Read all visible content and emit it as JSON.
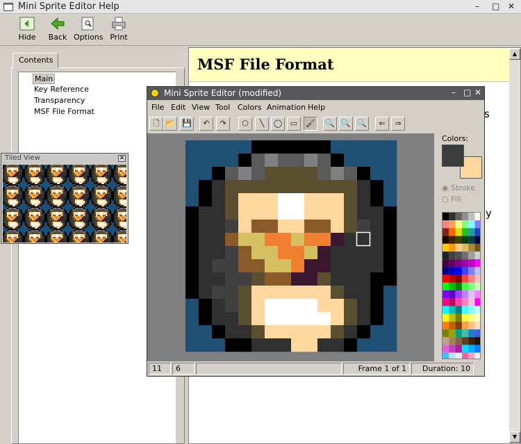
{
  "help_window": {
    "title": "Mini Sprite Editor Help",
    "controls": {
      "minimize": "–",
      "maximize": "□",
      "close": "✕"
    },
    "toolbar": [
      {
        "label": "Hide",
        "icon": "hide-icon"
      },
      {
        "label": "Back",
        "icon": "back-arrow-icon"
      },
      {
        "label": "Options",
        "icon": "options-icon"
      },
      {
        "label": "Print",
        "icon": "printer-icon"
      }
    ],
    "tab_label": "Contents",
    "tree_items": [
      "Main",
      "Key Reference",
      "Transparency",
      "MSF File Format"
    ],
    "selected_item": "Main",
    "doc_title": "MSF File Format",
    "doc_fragments": [
      "s",
      "y"
    ]
  },
  "tiled_view": {
    "title": "Tiled View",
    "close": "✕"
  },
  "editor": {
    "title": "Mini Sprite Editor (modified)",
    "controls": {
      "minimize": "–",
      "maximize": "□",
      "close": "✕"
    },
    "menu": [
      "File",
      "Edit",
      "View",
      "Tool",
      "Colors",
      "Animation",
      "Help"
    ],
    "tools": [
      {
        "name": "new-icon",
        "glyph": "🗋"
      },
      {
        "name": "open-icon",
        "glyph": "📂"
      },
      {
        "name": "save-icon",
        "glyph": "💾"
      },
      {
        "name": "undo-icon",
        "glyph": "↶"
      },
      {
        "name": "redo-icon",
        "glyph": "↷"
      },
      {
        "name": "polygon-tool-icon",
        "glyph": "⬠"
      },
      {
        "name": "line-tool-icon",
        "glyph": "╲"
      },
      {
        "name": "ellipse-tool-icon",
        "glyph": "◯"
      },
      {
        "name": "rectangle-tool-icon",
        "glyph": "▭"
      },
      {
        "name": "brush-tool-icon",
        "glyph": "🖌"
      },
      {
        "name": "zoom-fit-icon",
        "glyph": "🔍"
      },
      {
        "name": "zoom-in-icon",
        "glyph": "🔍"
      },
      {
        "name": "zoom-out-icon",
        "glyph": "🔍"
      },
      {
        "name": "previous-frame-icon",
        "glyph": "⇐"
      },
      {
        "name": "next-frame-icon",
        "glyph": "⇒"
      }
    ],
    "active_tool": "brush-tool-icon",
    "colors_label": "Colors:",
    "primary_color": "#3c3c3c",
    "secondary_color": "#ffd8a0",
    "stroke_label": "Stroke",
    "fill_label": "Fill",
    "stroke_selected": true,
    "status": {
      "x": "11",
      "y": "6",
      "frame": "Frame 1 of 1",
      "duration": "Duration: 10"
    },
    "palette": [
      [
        "#000000",
        "#303030",
        "#606060",
        "#909090",
        "#c0c0c0",
        "#ffffff"
      ],
      [
        "#ff8080",
        "#ffa060",
        "#ffff80",
        "#80ff80",
        "#80ffff",
        "#8080ff"
      ],
      [
        "#802020",
        "#ff6000",
        "#e0e000",
        "#20c020",
        "#20a0a0",
        "#2040c0"
      ],
      [
        "#200000",
        "#402000",
        "#404000",
        "#004000",
        "#004040",
        "#000040"
      ],
      [
        "#ffcc00",
        "#ff9900",
        "#ffcc88",
        "#ddbb66",
        "#aa8833",
        "#775522"
      ],
      [
        "#202020",
        "#404040",
        "#505050",
        "#707070",
        "#a0a0a0",
        "#d0d0d0"
      ],
      [
        "#400040",
        "#600060",
        "#800080",
        "#a000a0",
        "#c000c0",
        "#ff00ff"
      ],
      [
        "#000080",
        "#0000c0",
        "#0000ff",
        "#4040ff",
        "#8080ff",
        "#c0c0ff"
      ],
      [
        "#ff0000",
        "#c00000",
        "#800000",
        "#ff4040",
        "#ff8080",
        "#ffc0c0"
      ],
      [
        "#00ff00",
        "#00c000",
        "#008000",
        "#40ff40",
        "#80ff80",
        "#c0ffc0"
      ],
      [
        "#8000ff",
        "#6000c0",
        "#a040ff",
        "#c080ff",
        "#e0c0ff",
        "#ff80ff"
      ],
      [
        "#ff0080",
        "#c00060",
        "#ff40a0",
        "#ff80c0",
        "#ffc0e0",
        "#ff00ff"
      ],
      [
        "#00ffff",
        "#00c0c0",
        "#008080",
        "#40ffff",
        "#80ffff",
        "#c0ffff"
      ],
      [
        "#ffff00",
        "#c0c000",
        "#808000",
        "#ffff40",
        "#ffff80",
        "#ffffc0"
      ],
      [
        "#ff8000",
        "#c06000",
        "#804000",
        "#ffa040",
        "#ffc080",
        "#ffe0c0"
      ],
      [
        "#808000",
        "#a0a000",
        "#00a080",
        "#40c0a0",
        "#2080c0",
        "#4060e0"
      ],
      [
        "#c0a080",
        "#a08060",
        "#806040",
        "#604020",
        "#402000",
        "#201000"
      ],
      [
        "#e060e0",
        "#c040c0",
        "#a020a0",
        "#00e0ff",
        "#00b0ff",
        "#0080ff"
      ],
      [
        "#40c0ff",
        "#c0e0ff",
        "#e0f0ff",
        "#ff60a0",
        "#ffa0c0",
        "#fff0f8"
      ]
    ],
    "sprite_palette": {
      "B": "#1f4f72",
      "K": "#000000",
      "D": "#303030",
      "M": "#404040",
      "G": "#5a5a5a",
      "L": "#808080",
      "O": "#5a5030",
      "S": "#ffd8a0",
      "W": "#ffffff",
      "R": "#8a5a28",
      "Y": "#d4c060",
      "N": "#f08030",
      "P": "#3c1830",
      "H": "#c0b080"
    },
    "sprite_rows": [
      "BBBBBKKKKKKBBBBB",
      "BBBBKGLGGLGKBBBB",
      "BBKGLGOOOOGLGKBB",
      "BKDOOOOOOOOOODKB",
      "BKDOSSSWWSSSODKB",
      "KDDOSSSWWSSSODDK",
      "KDDMSRRSSRRSOMDK",
      "KDDRYYNNYNNPDDDK",
      "KDDMRYYNNYPDDDDK",
      "KDMMRRYYNPPDDDDK",
      "KDDMMORRPPODDDKK",
      "KDMMOSSSSSSODDKB",
      "BKDMOSWWWWSSODKB",
      "BKDDOSWWWWWSODKB",
      "BBKDDOSSSSSODKBB",
      "BBBKKDDDSSDDKBBB"
    ]
  }
}
